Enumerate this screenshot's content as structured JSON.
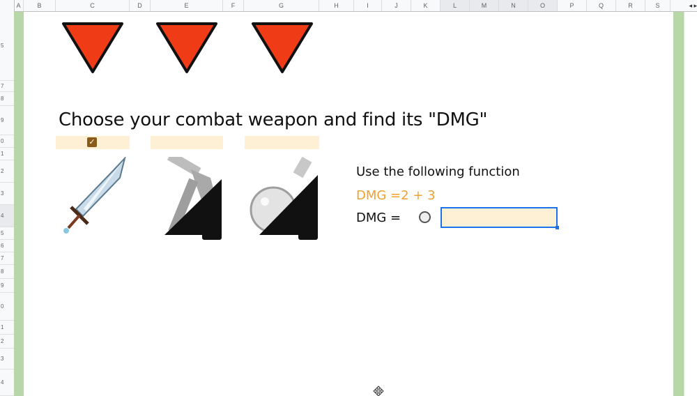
{
  "sheet": {
    "columns": [
      "A",
      "B",
      "C",
      "D",
      "E",
      "F",
      "G",
      "H",
      "I",
      "J",
      "K",
      "L",
      "M",
      "N",
      "O",
      "P",
      "Q",
      "R",
      "S"
    ],
    "rows": [
      "5",
      "7",
      "8",
      "9",
      "0",
      "1",
      "2",
      "3",
      "4",
      "5",
      "6",
      "7",
      "8",
      "9",
      "0",
      "1",
      "2",
      "3",
      "4"
    ],
    "scroll_arrows": "◂ ▸"
  },
  "heading": "Choose your combat weapon and find its \"DMG\"",
  "weapons": [
    {
      "name": "sword",
      "selected": true,
      "locked": false
    },
    {
      "name": "axe",
      "selected": false,
      "locked": true
    },
    {
      "name": "potion",
      "selected": false,
      "locked": true
    }
  ],
  "checkbox_mark": "✓",
  "instruction": "Use the following function",
  "formula": "DMG =2 + 3",
  "dmg_label": "DMG =",
  "answer_value": "",
  "colors": {
    "triangle_fill": "#ef3b16",
    "accent_orange": "#f0a030",
    "answer_bg": "#fdf0d4",
    "selection_blue": "#1a73e8",
    "side_strip": "#b7d7a8"
  }
}
